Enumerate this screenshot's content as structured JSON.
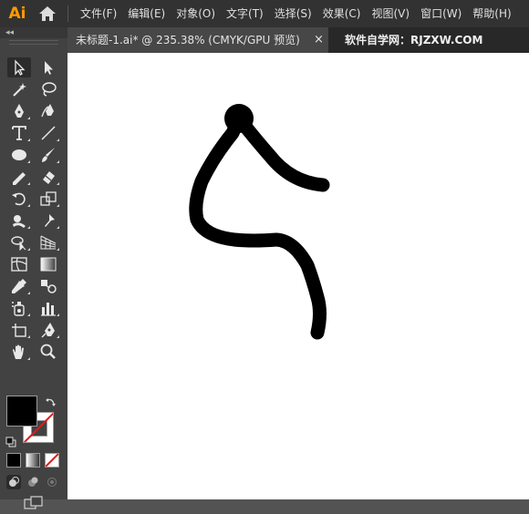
{
  "app": {
    "logo": "Ai",
    "icons": {
      "home": "home-icon"
    }
  },
  "menu": {
    "items": [
      "文件(F)",
      "编辑(E)",
      "对象(O)",
      "文字(T)",
      "选择(S)",
      "效果(C)",
      "视图(V)",
      "窗口(W)",
      "帮助(H)"
    ]
  },
  "tabs": {
    "active": {
      "title": "未标题-1.ai* @ 235.38% (CMYK/GPU 预览)",
      "close": "×"
    },
    "inactive": {
      "title": "软件自学网：RJZXW.COM"
    }
  },
  "toolbar": {
    "collapse": "◂◂",
    "tools": [
      "selection-tool",
      "direct-selection-tool",
      "magic-wand-tool",
      "lasso-tool",
      "pen-tool",
      "curvature-tool",
      "type-tool",
      "line-segment-tool",
      "ellipse-tool",
      "paintbrush-tool",
      "pencil-tool",
      "eraser-tool",
      "rotate-tool",
      "scale-tool",
      "warp-tool",
      "puppet-warp-tool",
      "shape-builder-tool",
      "perspective-grid-tool",
      "mesh-tool",
      "gradient-tool",
      "eyedropper-tool",
      "blend-tool",
      "symbol-sprayer-tool",
      "column-graph-tool",
      "artboard-tool",
      "slice-tool",
      "hand-tool",
      "zoom-tool"
    ],
    "selected_tool": "selection-tool",
    "fill_color": "#000000",
    "stroke_color": "none",
    "color_modes": [
      "color",
      "gradient",
      "none"
    ],
    "draw_modes": [
      "draw-normal",
      "draw-behind",
      "draw-inside"
    ]
  },
  "canvas": {
    "zoom": "235.38%",
    "background": "#ffffff",
    "artwork": {
      "stroke": "#000000",
      "shape": "stick-figure-stroke"
    }
  }
}
